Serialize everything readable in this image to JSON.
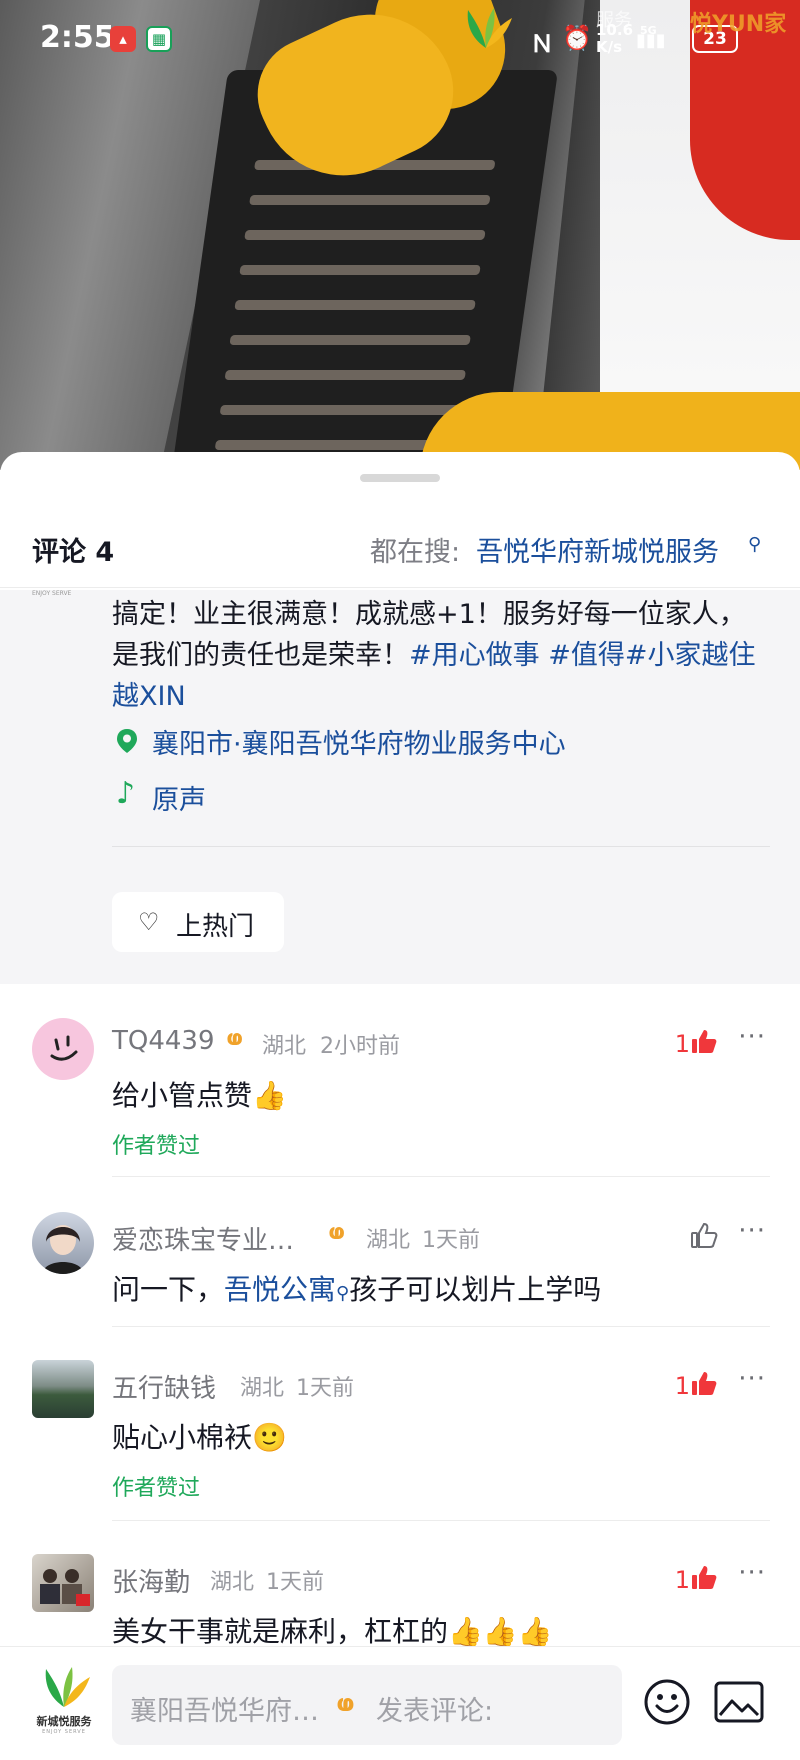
{
  "status_bar": {
    "time": "2:55",
    "net_speed_value": "10.6",
    "net_speed_unit": "K/s",
    "network": "5G",
    "battery": "23",
    "overlay_text": "服务",
    "corner_mark": "悦YUN家"
  },
  "sheet": {
    "title": "评论 4",
    "search_prefix": "都在搜:",
    "search_link": "吾悦华府新城悦服务"
  },
  "description": {
    "text_plain": "搞定！业主很满意！成就感+1！服务好每一位家人，是我们的责任也是荣幸！",
    "tag1": "#用心做事",
    "tag2": "#值得",
    "tag3": "#小家越住越XIN",
    "location": "襄阳市·襄阳吾悦华府物业服务中心",
    "music": "原声",
    "hot_button": "上热门"
  },
  "comments": [
    {
      "user": "TQ4439",
      "region": "湖北",
      "time": "2小时前",
      "text": "给小管点赞👍",
      "author_liked": "作者赞过",
      "likes": "1"
    },
    {
      "user": "爱恋珠宝专业…",
      "region": "湖北",
      "time": "1天前",
      "text_before": "问一下，",
      "text_link": "吾悦公寓",
      "text_after": "孩子可以划片上学吗",
      "likes": ""
    },
    {
      "user": "五行缺钱",
      "region": "湖北",
      "time": "1天前",
      "text": "贴心小棉袄🙂",
      "author_liked": "作者赞过",
      "likes": "1"
    },
    {
      "user": "张海勤",
      "region": "湖北",
      "time": "1天前",
      "text": "美女干事就是麻利，杠杠的👍👍👍",
      "likes": "1"
    }
  ],
  "composer": {
    "account": "襄阳吾悦华府…",
    "placeholder": "发表评论:",
    "brand_name": "新城悦服务",
    "brand_sub": "ENJOY SERVE"
  },
  "colors": {
    "link": "#1b4f9c",
    "green": "#1fa85a",
    "like_red": "#f0373b",
    "badge_orange": "#f0a22a"
  }
}
